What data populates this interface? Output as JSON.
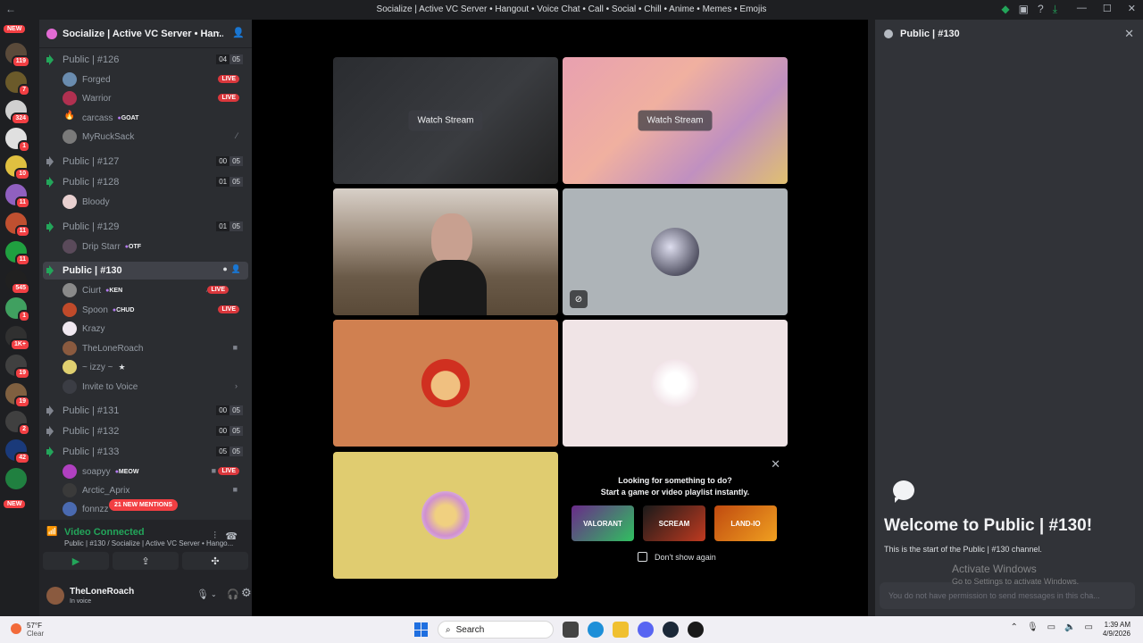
{
  "window": {
    "title": "Socialize | Active VC Server • Hangout • Voice Chat • Call • Social • Chill • Anime • Memes • Emojis"
  },
  "rail": {
    "new_top": "NEW",
    "new_bottom": "NEW",
    "servers": [
      {
        "badge": "119",
        "color": "#5a4a3a"
      },
      {
        "badge": "7",
        "color": "#6b5a2a"
      },
      {
        "badge": "324",
        "color": "#d0d0d0"
      },
      {
        "badge": "1",
        "color": "#e0e0e0"
      },
      {
        "badge": "10",
        "color": "#e0c040"
      },
      {
        "badge": "11",
        "color": "#9060c0"
      },
      {
        "badge": "11",
        "color": "#c05030"
      },
      {
        "badge": "11",
        "color": "#20a040"
      },
      {
        "badge": "545",
        "color": "#202020"
      },
      {
        "badge": "1",
        "color": "#40a060"
      },
      {
        "badge": "1K+",
        "color": "#303030"
      },
      {
        "badge": "19",
        "color": "#404040"
      },
      {
        "badge": "19",
        "color": "#806040"
      },
      {
        "badge": "2",
        "color": "#404040"
      },
      {
        "badge": "42",
        "color": "#1a3a7a"
      },
      {
        "badge": "",
        "color": "#208040"
      }
    ]
  },
  "guild": {
    "name": "Socialize | Active VC Server • Han...",
    "mentions": "21 NEW MENTIONS"
  },
  "channels": {
    "c126": {
      "name": "Public | #126",
      "count": "04",
      "limit": "05"
    },
    "c127": {
      "name": "Public | #127",
      "count": "00",
      "limit": "05"
    },
    "c128": {
      "name": "Public | #128",
      "count": "01",
      "limit": "05"
    },
    "c129": {
      "name": "Public | #129",
      "count": "01",
      "limit": "05"
    },
    "c130": {
      "name": "Public | #130"
    },
    "c131": {
      "name": "Public | #131",
      "count": "00",
      "limit": "05"
    },
    "c132": {
      "name": "Public | #132",
      "count": "00",
      "limit": "05"
    },
    "c133": {
      "name": "Public | #133",
      "count": "05",
      "limit": "05"
    }
  },
  "members": {
    "forged": "Forged",
    "warrior": "Warrior",
    "carcass": "carcass",
    "carcass_tag": "GOAT",
    "myrucksack": "MyRuckSack",
    "bloody": "Bloody",
    "drip": "Drip Starr",
    "drip_tag": "OTF",
    "curt": "Ciurt",
    "curt_tag": "KEN",
    "spoon": "Spoon",
    "spoon_tag": "CHUD",
    "krazy": "Krazy",
    "loneroach": "TheLoneRoach",
    "izzy": "~ izzy ~",
    "invite": "Invite to Voice",
    "soapyy": "soapyy",
    "soapyy_tag": "MEOW",
    "arctic": "Arctic_Aprix",
    "fonnzz": "fonnzz"
  },
  "live_label": "LIVE",
  "voice_panel": {
    "status": "Video Connected",
    "location": "Public | #130 / Socialize | Active VC Server • Hango..."
  },
  "user": {
    "name": "TheLoneRoach",
    "status": "In voice"
  },
  "stage": {
    "watch_label": "Watch Stream",
    "activity_title": "Looking for something to do?",
    "activity_sub": "Start a game or video playlist instantly.",
    "dont_show": "Don't show again",
    "games": [
      "VALORANT",
      "SCREAM",
      "LAND-IO"
    ]
  },
  "chat": {
    "header": "Public | #130",
    "welcome": "Welcome to Public | #130!",
    "start": "This is the start of the Public | #130 channel.",
    "watermark_title": "Activate Windows",
    "watermark_sub": "Go to Settings to activate Windows.",
    "input_placeholder": "You do not have permission to send messages in this cha..."
  },
  "taskbar": {
    "temp": "57°F",
    "weather": "Clear",
    "search": "Search",
    "time": "1:39 AM",
    "date": "4/9/2026"
  },
  "colors": {
    "live": "#da373c",
    "connected": "#23a55a",
    "accent": "#5865f2"
  }
}
